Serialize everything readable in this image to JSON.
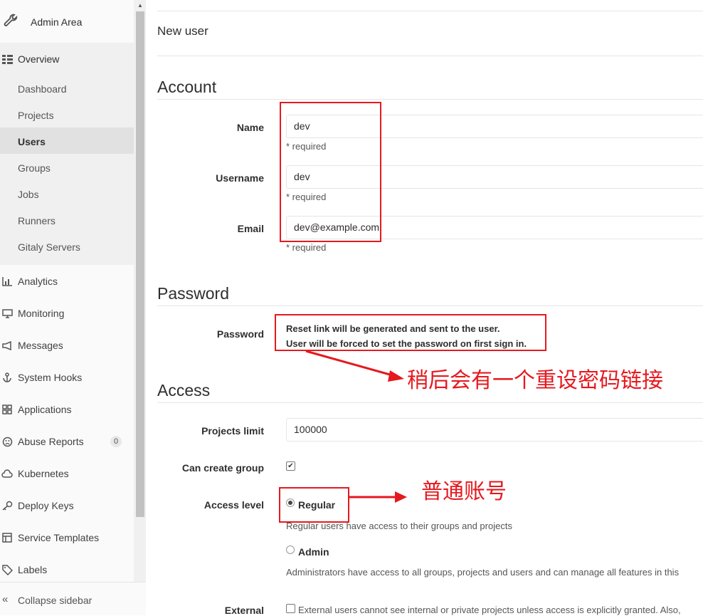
{
  "sidebar": {
    "header": "Admin Area",
    "overview": "Overview",
    "overview_items": [
      {
        "label": "Dashboard"
      },
      {
        "label": "Projects"
      },
      {
        "label": "Users"
      },
      {
        "label": "Groups"
      },
      {
        "label": "Jobs"
      },
      {
        "label": "Runners"
      },
      {
        "label": "Gitaly Servers"
      }
    ],
    "items": [
      {
        "label": "Analytics",
        "icon": "chart-icon"
      },
      {
        "label": "Monitoring",
        "icon": "monitor-icon"
      },
      {
        "label": "Messages",
        "icon": "megaphone-icon"
      },
      {
        "label": "System Hooks",
        "icon": "hook-icon"
      },
      {
        "label": "Applications",
        "icon": "grid-icon"
      },
      {
        "label": "Abuse Reports",
        "icon": "frown-icon",
        "badge": "0"
      },
      {
        "label": "Kubernetes",
        "icon": "cloud-icon"
      },
      {
        "label": "Deploy Keys",
        "icon": "key-icon"
      },
      {
        "label": "Service Templates",
        "icon": "template-icon"
      },
      {
        "label": "Labels",
        "icon": "label-icon"
      }
    ],
    "collapse": "Collapse sidebar"
  },
  "main": {
    "page_title": "New user",
    "account": {
      "title": "Account",
      "name_label": "Name",
      "name_value": "dev",
      "username_label": "Username",
      "username_value": "dev",
      "email_label": "Email",
      "email_value": "dev@example.com",
      "required": "* required"
    },
    "password": {
      "title": "Password",
      "label": "Password",
      "line1": "Reset link will be generated and sent to the user.",
      "line2": "User will be forced to set the password on first sign in."
    },
    "access": {
      "title": "Access",
      "projects_limit_label": "Projects limit",
      "projects_limit_value": "100000",
      "can_create_group_label": "Can create group",
      "access_level_label": "Access level",
      "regular_label": "Regular",
      "regular_desc": "Regular users have access to their groups and projects",
      "admin_label": "Admin",
      "admin_desc": "Administrators have access to all groups, projects and users and can manage all features in this",
      "external_label": "External",
      "external_desc": "External users cannot see internal or private projects unless access is explicitly granted. Also,"
    }
  },
  "annotations": {
    "reset_note": "稍后会有一个重设密码链接",
    "regular_note": "普通账号",
    "color": "#e5191f"
  }
}
